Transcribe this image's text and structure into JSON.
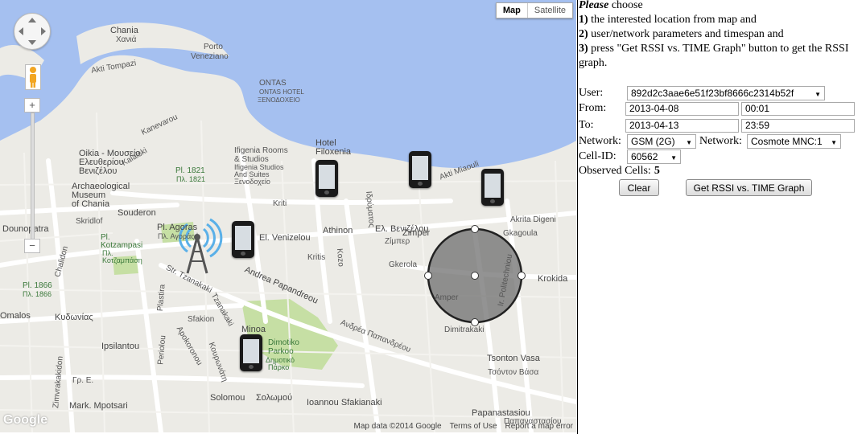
{
  "map": {
    "type_buttons": [
      "Map",
      "Satellite"
    ],
    "active_type": "Map",
    "attribution": [
      "Map data ©2014 Google",
      "Terms of Use",
      "Report a map error"
    ],
    "logo_text": "Google",
    "labels": [
      "Chania",
      "Χανιά",
      "Porto",
      "Veneziano",
      "Akti Tompazi",
      "ONTAS",
      "ONTAS HOTEL",
      "ΞΕΝΟΔΟΧΕΙΟ",
      "Kanevarou",
      "Oikia - Μουσείο",
      "Ελευθερίου",
      "Βενιζέλου",
      "Pl. 1821",
      "Πλ. 1821",
      "Hotel",
      "Filoxenia",
      "Ifigenia Rooms",
      "& Studios",
      "Ifigenia Studios",
      "And Suites",
      "Ξενοδοχείο",
      "Archaeological",
      "Museum",
      "of Chania",
      "Skridlof",
      "Souderon",
      "Kriti",
      "Athinon",
      "El. Venizelou",
      "Ελ. Βενιζέλου",
      "Pl. Agoras",
      "Πλ. Αγοράς",
      "Pl.",
      "Kotzampasi",
      "Πλ.",
      "Κοτζαμπάση",
      "Akti Miaouli",
      "Akrita Digeni",
      "Gkagoula",
      "Zimper",
      "Ζίμπερ",
      "Gkerola",
      "Kritis",
      "Amper",
      "Dimitrakaki",
      "Ir. Politechniou",
      "Krokida",
      "Pl. 1866",
      "Πλ. 1866",
      "Omalos",
      "Κυδωνίας",
      "Str. Tzanakaki",
      "Andrea Papandreou",
      "Ανδρέα Παπανδρέου",
      "Minoa",
      "Dimotiko",
      "Parkoo",
      "Δημοτικό",
      "Πάρκο",
      "Ipsilantou",
      "Solomou",
      "Σολωμού",
      "Ioannou Sfakianaki",
      "Mark. Mpotsari",
      "Tsonton Vasa",
      "Τσόντον Βάσα",
      "Papanastasiou",
      "Παπαναστασίου",
      "Dounopatra",
      "Chalidon",
      "Plastira",
      "Periolou",
      "Apokoronou",
      "Zimvrakakidon",
      "Κουρωνάτη",
      "Γρ. Ε.",
      "Kozo",
      "Ιδρύματος",
      "Tzanakaki",
      "Sfakion",
      "Kalaiski"
    ]
  },
  "panel": {
    "intro_italic": "Please",
    "intro_rest": " choose",
    "steps": [
      {
        "num": "1)",
        "text": " the interested location from map and"
      },
      {
        "num": "2)",
        "text": " user/network parameters and timespan and"
      },
      {
        "num": "3)",
        "text": " press \"Get RSSI vs. TIME Graph\" button to get the RSSI graph."
      }
    ],
    "user_label": "User:",
    "user_value": "892d2c3aae6e51f23bf8666c2314b52f",
    "from_label": "From:",
    "from_date": "2013-04-08",
    "from_time": "00:01",
    "to_label": "To:",
    "to_date": "2013-04-13",
    "to_time": "23:59",
    "network_label": "Network:",
    "network_value": "GSM (2G)",
    "network2_label": "Network:",
    "network2_value": "Cosmote MNC:1",
    "cellid_label": "Cell-ID:",
    "cellid_value": "60562",
    "observed_label": "Observed Cells:",
    "observed_value": "5",
    "clear_button": "Clear",
    "graph_button": "Get RSSI vs. TIME Graph"
  },
  "colors": {
    "sea": "#a5c0f0",
    "land": "#ecebe6",
    "road": "#ffffff",
    "park": "#c6dfa4",
    "selection_circle": "#6f6f6f"
  }
}
